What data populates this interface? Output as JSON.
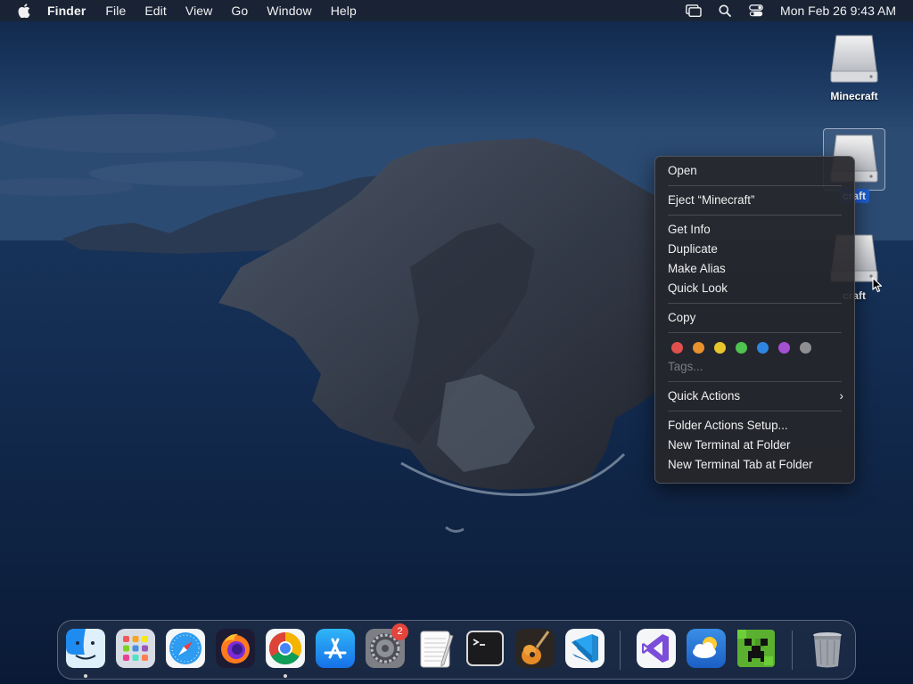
{
  "menubar": {
    "apple_icon": "apple-logo-icon",
    "items": [
      "Finder",
      "File",
      "Edit",
      "View",
      "Go",
      "Window",
      "Help"
    ],
    "status_icons": [
      "screen-mirroring-icon",
      "search-icon",
      "control-center-icon"
    ],
    "clock": "Mon Feb 26  9:43 AM"
  },
  "desktop": {
    "icons": [
      {
        "label": "Minecraft",
        "icon": "external-drive-icon",
        "selected": false
      },
      {
        "label": "craft",
        "icon": "external-drive-icon",
        "selected": true
      },
      {
        "label": "craft",
        "icon": "external-drive-icon",
        "selected": false
      }
    ]
  },
  "context_menu": {
    "open": "Open",
    "eject": "Eject “Minecraft”",
    "get_info": "Get Info",
    "duplicate": "Duplicate",
    "make_alias": "Make Alias",
    "quick_look": "Quick Look",
    "copy": "Copy",
    "tag_colors": [
      "#e0514e",
      "#e8912d",
      "#e8c62b",
      "#4fc24f",
      "#2f86e0",
      "#a54fd1",
      "#8e8e93"
    ],
    "tags": "Tags...",
    "quick_actions": "Quick Actions",
    "chevron": "›",
    "folder_actions": "Folder Actions Setup...",
    "new_terminal": "New Terminal at Folder",
    "new_terminal_tab": "New Terminal Tab at Folder"
  },
  "dock": {
    "apps": [
      {
        "name": "Finder",
        "icon": "finder-icon",
        "running": true
      },
      {
        "name": "Launchpad",
        "icon": "launchpad-icon",
        "running": false
      },
      {
        "name": "Safari",
        "icon": "safari-icon",
        "running": false
      },
      {
        "name": "Firefox",
        "icon": "firefox-icon",
        "running": false
      },
      {
        "name": "Google Chrome",
        "icon": "chrome-icon",
        "running": true
      },
      {
        "name": "App Store",
        "icon": "app-store-icon",
        "running": false
      },
      {
        "name": "System Preferences",
        "icon": "system-preferences-icon",
        "running": false,
        "badge": "2"
      },
      {
        "name": "TextEdit",
        "icon": "textedit-icon",
        "running": false
      },
      {
        "name": "Terminal",
        "icon": "terminal-icon",
        "running": false
      },
      {
        "name": "GarageBand",
        "icon": "garageband-icon",
        "running": false
      },
      {
        "name": "Visual Studio Code",
        "icon": "vscode-icon",
        "running": false
      },
      {
        "name": "Visual Studio",
        "icon": "visual-studio-icon",
        "running": false
      },
      {
        "name": "Weather",
        "icon": "weather-icon",
        "running": false
      },
      {
        "name": "Minecraft",
        "icon": "minecraft-icon",
        "running": false
      },
      {
        "name": "Trash",
        "icon": "trash-icon",
        "running": false
      }
    ]
  }
}
